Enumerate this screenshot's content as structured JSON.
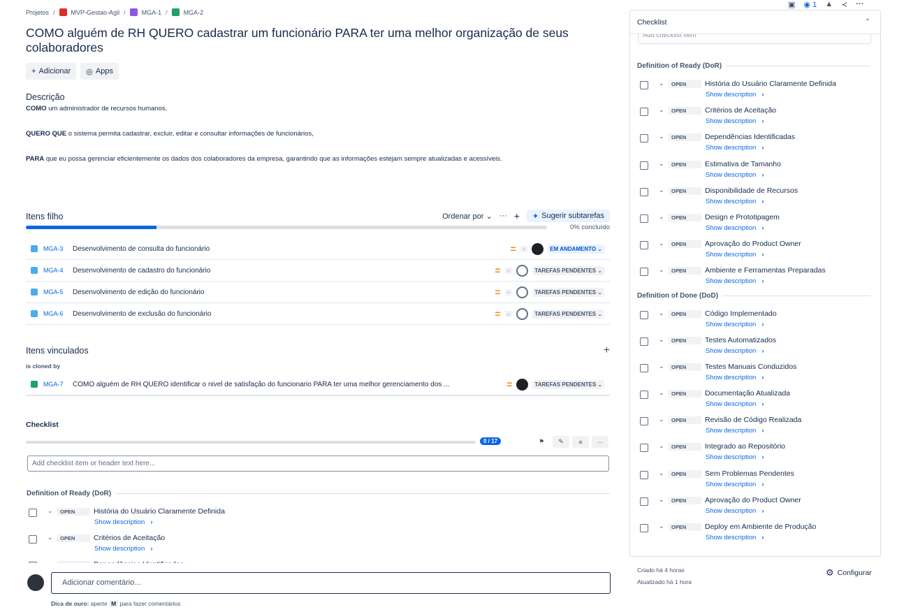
{
  "breadcrumb": [
    "Projetos",
    "MVP-Gestao-Agil",
    "MGA-1",
    "MGA-2"
  ],
  "issue": {
    "title": "COMO alguém de RH QUERO cadastrar um funcionário PARA ter uma melhor organização de seus colaboradores",
    "add_label": "Adicionar",
    "apps_label": "Apps"
  },
  "description": {
    "heading": "Descrição",
    "line1_bold": "COMO",
    "line1_text": " um administrador de recursos humanos,",
    "line2_bold": "QUERO QUE",
    "line2_text": " o sistema permita cadastrar, excluir, editar e consultar informações de funcionários,",
    "line3_bold": "PARA",
    "line3_text": " que eu possa gerenciar eficientemente os dados dos colaboradores da empresa, garantindo que as informações estejam sempre atualizadas e acessíveis."
  },
  "children": {
    "heading": "Itens filho",
    "order_label": "Ordenar por",
    "suggest_label": "Sugerir subtarefas",
    "progress_text": "0% concluído",
    "progress_fraction": 0.25,
    "items": [
      {
        "key": "MGA-3",
        "summary": "Desenvolvimento de consulta do funcionário",
        "priority": "=",
        "points": "-",
        "status": "EM ANDAMENTO"
      },
      {
        "key": "MGA-4",
        "summary": "Desenvolvimento de cadastro do funcionário",
        "priority": "=",
        "points": "-",
        "status": "TAREFAS PENDENTES"
      },
      {
        "key": "MGA-5",
        "summary": "Desenvolvimento de edição do funcionário",
        "priority": "=",
        "points": "-",
        "status": "TAREFAS PENDENTES"
      },
      {
        "key": "MGA-6",
        "summary": "Desenvolvimento de exclusão do funcionário",
        "priority": "=",
        "points": "-",
        "status": "TAREFAS PENDENTES"
      }
    ]
  },
  "linked": {
    "heading": "Itens vinculados",
    "relation": "is cloned by",
    "item": {
      "key": "MGA-7",
      "summary": "COMO alguém de RH QUERO identificar o nivel de satisfação do funcionario PARA ter uma melhor gerenciamento dos ...",
      "priority": "=",
      "status": "TAREFAS PENDENTES"
    }
  },
  "checklist": {
    "heading": "Checklist",
    "progress_badge": "0 / 17",
    "input_placeholder": "Add checklist item or header text here...",
    "side_input_placeholder": "Add checklist item",
    "open_label": "OPEN",
    "show_description": "Show description",
    "dor_heading": "Definition of Ready (DoR)",
    "dod_heading": "Definition of Done (DoD)",
    "dor": [
      "História do Usuário Claramente Definida",
      "Critérios de Aceitação",
      "Dependências Identificadas",
      "Estimativa de Tamanho",
      "Disponibilidade de Recursos",
      "Design e Prototipagem",
      "Aprovação do Product Owner",
      "Ambiente e Ferramentas Preparadas"
    ],
    "dod": [
      "Código Implementado",
      "Testes Automatizados",
      "Testes Manuais Conduzidos",
      "Documentação Atualizada",
      "Revisão de Código Realizada",
      "Integrado ao Repositório",
      "Sem Problemas Pendentes",
      "Aprovação do Product Owner",
      "Deploy em Ambiente de Produção"
    ],
    "main_partial_item": "Dependências Identificadas"
  },
  "comment": {
    "placeholder": "Adicionar comentário...",
    "tip_bold": "Dica de ouro:",
    "tip_text1": " aperte ",
    "tip_key": "M",
    "tip_text2": " para fazer comentários"
  },
  "side": {
    "header": "Checklist",
    "created": "Criado há 4 horas",
    "updated": "Atualizado há 1 hora",
    "configure": "Configurar",
    "watch_count": "1"
  },
  "colors": {
    "accent": "#0c66e4",
    "priority": "#f18d13",
    "story": "#22a06b",
    "subtask": "#4bade8"
  }
}
